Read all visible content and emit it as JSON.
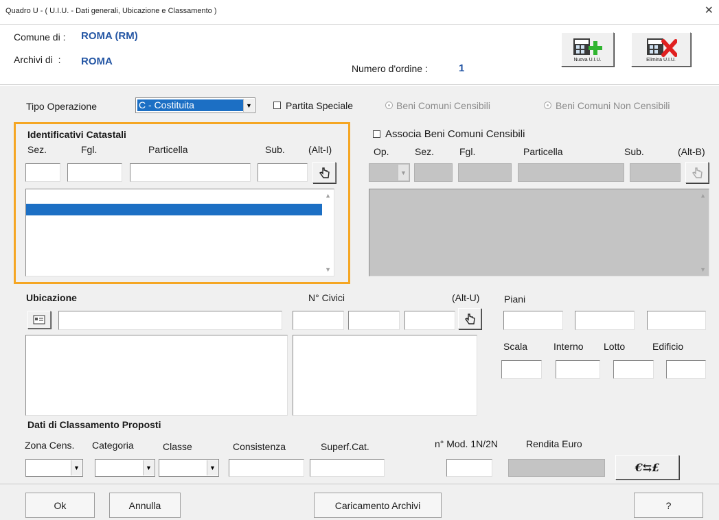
{
  "window": {
    "title": "Quadro U - ( U.I.U. - Dati generali, Ubicazione e Classamento )",
    "close_glyph": "✕"
  },
  "header": {
    "comune_label": "Comune di",
    "comune_value": "ROMA (RM)",
    "archivi_label": "Archivi di",
    "archivi_value": "ROMA",
    "ordine_label": "Numero d'ordine :",
    "ordine_value": "1",
    "colon": ":",
    "nuova_label": "Nuova U.I.U.",
    "elimina_label": "Elimina U.I.U.",
    "nuova_icon": "building-plus-icon",
    "elimina_icon": "building-delete-icon"
  },
  "operazione": {
    "label": "Tipo Operazione",
    "value": "C - Costituita",
    "partita_speciale": "Partita Speciale",
    "beni_censibili": "Beni Comuni Censibili",
    "beni_non_censibili": "Beni Comuni Non Censibili"
  },
  "identificativi": {
    "title": "Identificativi Catastali",
    "col_sez": "Sez.",
    "col_fgl": "Fgl.",
    "col_particella": "Particella",
    "col_sub": "Sub.",
    "shortcut": "(Alt-I)",
    "add_icon": "hand-pointer-icon"
  },
  "associa": {
    "title": "Associa Beni Comuni Censibili",
    "col_op": "Op.",
    "col_sez": "Sez.",
    "col_fgl": "Fgl.",
    "col_particella": "Particella",
    "col_sub": "Sub.",
    "shortcut": "(Alt-B)"
  },
  "ubicazione": {
    "title": "Ubicazione",
    "civici_label": "N° Civici",
    "shortcut": "(Alt-U)",
    "piani_label": "Piani",
    "scala_label": "Scala",
    "interno_label": "Interno",
    "lotto_label": "Lotto",
    "edificio_label": "Edificio"
  },
  "classamento": {
    "title": "Dati di Classamento Proposti",
    "zona_label": "Zona Cens.",
    "categoria_label": "Categoria",
    "classe_label": "Classe",
    "consistenza_label": "Consistenza",
    "superf_label": "Superf.Cat.",
    "mod_label": "n° Mod. 1N/2N",
    "rendita_label": "Rendita Euro",
    "convert_label": "€⇆£"
  },
  "footer": {
    "ok": "Ok",
    "annulla": "Annulla",
    "caricamento": "Caricamento Archivi",
    "help": "?"
  },
  "colors": {
    "accent_blue": "#2456a4",
    "focus_orange": "#f5a623",
    "selection_blue": "#1c6fc4"
  }
}
